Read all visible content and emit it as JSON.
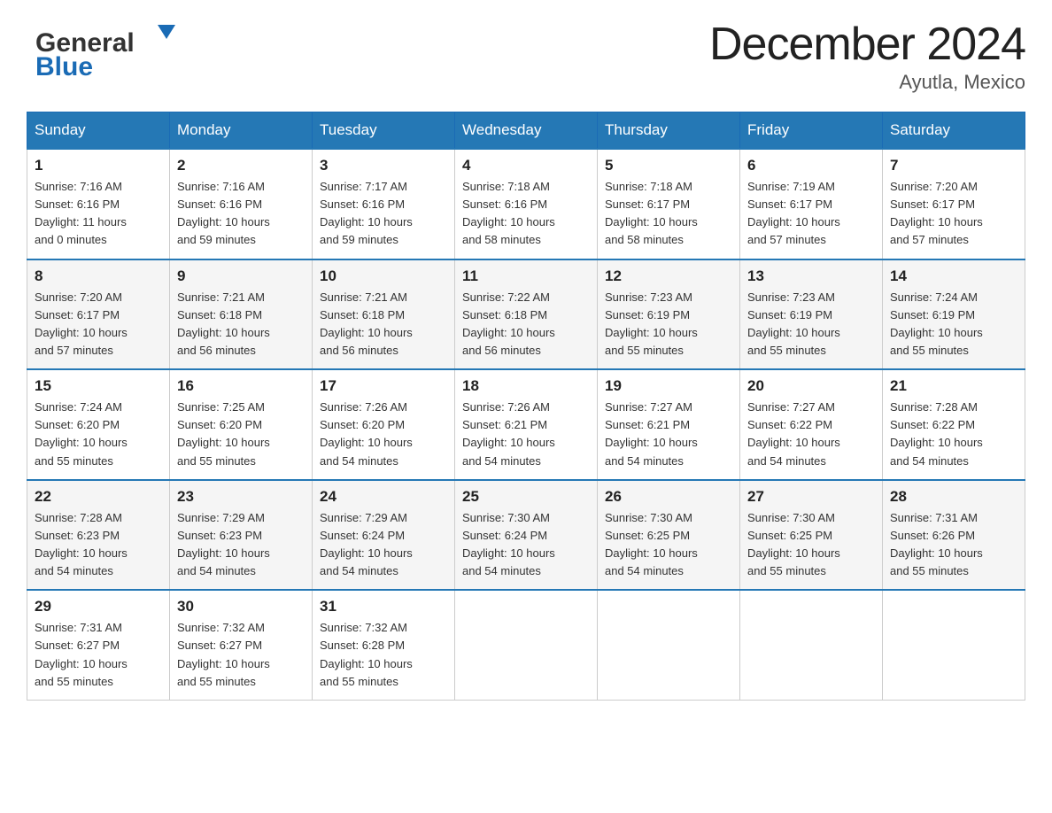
{
  "header": {
    "logo_general": "General",
    "logo_blue": "Blue",
    "main_title": "December 2024",
    "subtitle": "Ayutla, Mexico"
  },
  "days_of_week": [
    "Sunday",
    "Monday",
    "Tuesday",
    "Wednesday",
    "Thursday",
    "Friday",
    "Saturday"
  ],
  "weeks": [
    [
      {
        "day": "1",
        "sunrise": "7:16 AM",
        "sunset": "6:16 PM",
        "daylight": "11 hours and 0 minutes"
      },
      {
        "day": "2",
        "sunrise": "7:16 AM",
        "sunset": "6:16 PM",
        "daylight": "10 hours and 59 minutes"
      },
      {
        "day": "3",
        "sunrise": "7:17 AM",
        "sunset": "6:16 PM",
        "daylight": "10 hours and 59 minutes"
      },
      {
        "day": "4",
        "sunrise": "7:18 AM",
        "sunset": "6:16 PM",
        "daylight": "10 hours and 58 minutes"
      },
      {
        "day": "5",
        "sunrise": "7:18 AM",
        "sunset": "6:17 PM",
        "daylight": "10 hours and 58 minutes"
      },
      {
        "day": "6",
        "sunrise": "7:19 AM",
        "sunset": "6:17 PM",
        "daylight": "10 hours and 57 minutes"
      },
      {
        "day": "7",
        "sunrise": "7:20 AM",
        "sunset": "6:17 PM",
        "daylight": "10 hours and 57 minutes"
      }
    ],
    [
      {
        "day": "8",
        "sunrise": "7:20 AM",
        "sunset": "6:17 PM",
        "daylight": "10 hours and 57 minutes"
      },
      {
        "day": "9",
        "sunrise": "7:21 AM",
        "sunset": "6:18 PM",
        "daylight": "10 hours and 56 minutes"
      },
      {
        "day": "10",
        "sunrise": "7:21 AM",
        "sunset": "6:18 PM",
        "daylight": "10 hours and 56 minutes"
      },
      {
        "day": "11",
        "sunrise": "7:22 AM",
        "sunset": "6:18 PM",
        "daylight": "10 hours and 56 minutes"
      },
      {
        "day": "12",
        "sunrise": "7:23 AM",
        "sunset": "6:19 PM",
        "daylight": "10 hours and 55 minutes"
      },
      {
        "day": "13",
        "sunrise": "7:23 AM",
        "sunset": "6:19 PM",
        "daylight": "10 hours and 55 minutes"
      },
      {
        "day": "14",
        "sunrise": "7:24 AM",
        "sunset": "6:19 PM",
        "daylight": "10 hours and 55 minutes"
      }
    ],
    [
      {
        "day": "15",
        "sunrise": "7:24 AM",
        "sunset": "6:20 PM",
        "daylight": "10 hours and 55 minutes"
      },
      {
        "day": "16",
        "sunrise": "7:25 AM",
        "sunset": "6:20 PM",
        "daylight": "10 hours and 55 minutes"
      },
      {
        "day": "17",
        "sunrise": "7:26 AM",
        "sunset": "6:20 PM",
        "daylight": "10 hours and 54 minutes"
      },
      {
        "day": "18",
        "sunrise": "7:26 AM",
        "sunset": "6:21 PM",
        "daylight": "10 hours and 54 minutes"
      },
      {
        "day": "19",
        "sunrise": "7:27 AM",
        "sunset": "6:21 PM",
        "daylight": "10 hours and 54 minutes"
      },
      {
        "day": "20",
        "sunrise": "7:27 AM",
        "sunset": "6:22 PM",
        "daylight": "10 hours and 54 minutes"
      },
      {
        "day": "21",
        "sunrise": "7:28 AM",
        "sunset": "6:22 PM",
        "daylight": "10 hours and 54 minutes"
      }
    ],
    [
      {
        "day": "22",
        "sunrise": "7:28 AM",
        "sunset": "6:23 PM",
        "daylight": "10 hours and 54 minutes"
      },
      {
        "day": "23",
        "sunrise": "7:29 AM",
        "sunset": "6:23 PM",
        "daylight": "10 hours and 54 minutes"
      },
      {
        "day": "24",
        "sunrise": "7:29 AM",
        "sunset": "6:24 PM",
        "daylight": "10 hours and 54 minutes"
      },
      {
        "day": "25",
        "sunrise": "7:30 AM",
        "sunset": "6:24 PM",
        "daylight": "10 hours and 54 minutes"
      },
      {
        "day": "26",
        "sunrise": "7:30 AM",
        "sunset": "6:25 PM",
        "daylight": "10 hours and 54 minutes"
      },
      {
        "day": "27",
        "sunrise": "7:30 AM",
        "sunset": "6:25 PM",
        "daylight": "10 hours and 55 minutes"
      },
      {
        "day": "28",
        "sunrise": "7:31 AM",
        "sunset": "6:26 PM",
        "daylight": "10 hours and 55 minutes"
      }
    ],
    [
      {
        "day": "29",
        "sunrise": "7:31 AM",
        "sunset": "6:27 PM",
        "daylight": "10 hours and 55 minutes"
      },
      {
        "day": "30",
        "sunrise": "7:32 AM",
        "sunset": "6:27 PM",
        "daylight": "10 hours and 55 minutes"
      },
      {
        "day": "31",
        "sunrise": "7:32 AM",
        "sunset": "6:28 PM",
        "daylight": "10 hours and 55 minutes"
      },
      null,
      null,
      null,
      null
    ]
  ]
}
